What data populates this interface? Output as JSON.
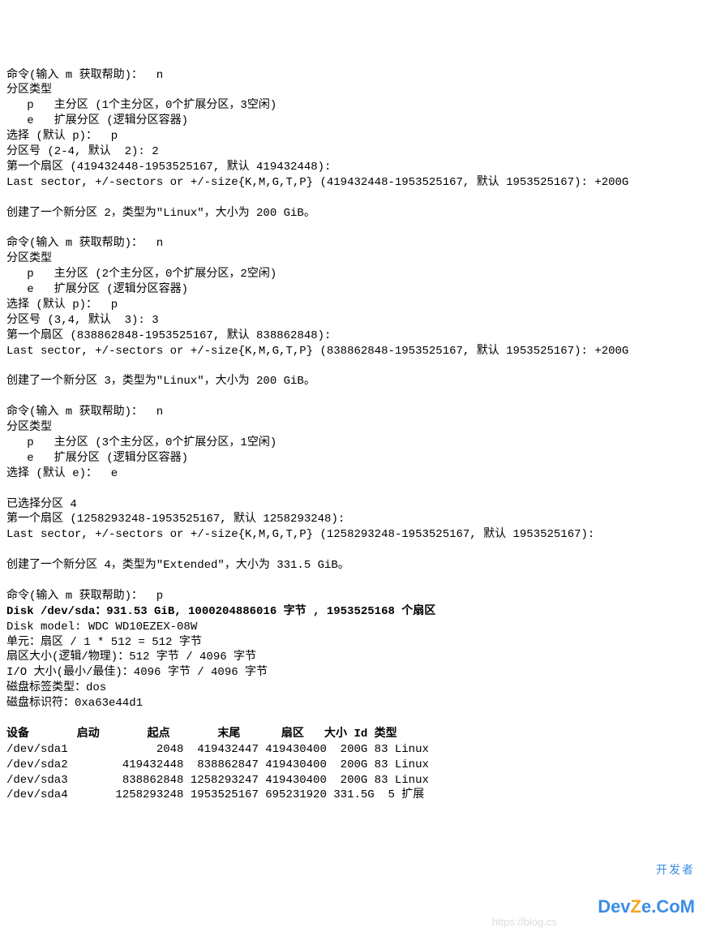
{
  "lines": {
    "l1": "命令(输入 m 获取帮助)：  n",
    "l2": "分区类型",
    "l3": "   p   主分区 (1个主分区，0个扩展分区，3空闲)",
    "l4": "   e   扩展分区 (逻辑分区容器)",
    "l5": "选择 (默认 p)：  p",
    "l6": "分区号 (2-4, 默认  2): 2",
    "l7": "第一个扇区 (419432448-1953525167, 默认 419432448):",
    "l8": "Last sector, +/-sectors or +/-size{K,M,G,T,P} (419432448-1953525167, 默认 1953525167): +200G",
    "blank1": "",
    "l9": "创建了一个新分区 2，类型为\"Linux\"，大小为 200 GiB。",
    "blank2": "",
    "l10": "命令(输入 m 获取帮助)：  n",
    "l11": "分区类型",
    "l12": "   p   主分区 (2个主分区，0个扩展分区，2空闲)",
    "l13": "   e   扩展分区 (逻辑分区容器)",
    "l14": "选择 (默认 p)：  p",
    "l15": "分区号 (3,4, 默认  3): 3",
    "l16": "第一个扇区 (838862848-1953525167, 默认 838862848):",
    "l17": "Last sector, +/-sectors or +/-size{K,M,G,T,P} (838862848-1953525167, 默认 1953525167): +200G",
    "blank3": "",
    "l18": "创建了一个新分区 3，类型为\"Linux\"，大小为 200 GiB。",
    "blank4": "",
    "l19": "命令(输入 m 获取帮助)：  n",
    "l20": "分区类型",
    "l21": "   p   主分区 (3个主分区，0个扩展分区，1空闲)",
    "l22": "   e   扩展分区 (逻辑分区容器)",
    "l23": "选择 (默认 e)：  e",
    "blank5": "",
    "l24": "已选择分区 4",
    "l25": "第一个扇区 (1258293248-1953525167, 默认 1258293248):",
    "l26": "Last sector, +/-sectors or +/-size{K,M,G,T,P} (1258293248-1953525167, 默认 1953525167):",
    "blank6": "",
    "l27": "创建了一个新分区 4，类型为\"Extended\"，大小为 331.5 GiB。",
    "blank7": "",
    "l28": "命令(输入 m 获取帮助)：  p",
    "l29": "Disk /dev/sda：931.53 GiB, 1000204886016 字节 , 1953525168 个扇区",
    "l30": "Disk model: WDC WD10EZEX-08W",
    "l31": "单元：扇区 / 1 * 512 = 512 字节",
    "l32": "扇区大小(逻辑/物理)：512 字节 / 4096 字节",
    "l33": "I/O 大小(最小/最佳)：4096 字节 / 4096 字节",
    "l34": "磁盘标签类型：dos",
    "l35": "磁盘标识符：0xa63e44d1",
    "blank8": "",
    "header": "设备       启动       起点       末尾      扇区   大小 Id 类型",
    "row1": "/dev/sda1             2048  419432447 419430400  200G 83 Linux",
    "row2": "/dev/sda2        419432448  838862847 419430400  200G 83 Linux",
    "row3": "/dev/sda3        838862848 1258293247 419430400  200G 83 Linux",
    "row4": "/dev/sda4       1258293248 1953525167 695231920 331.5G  5 扩展"
  },
  "watermark": {
    "cn": "开发者",
    "en_left": "Dev",
    "en_mid": "Z",
    "en_right": "e.CoM",
    "url": "https://blog.cs"
  }
}
